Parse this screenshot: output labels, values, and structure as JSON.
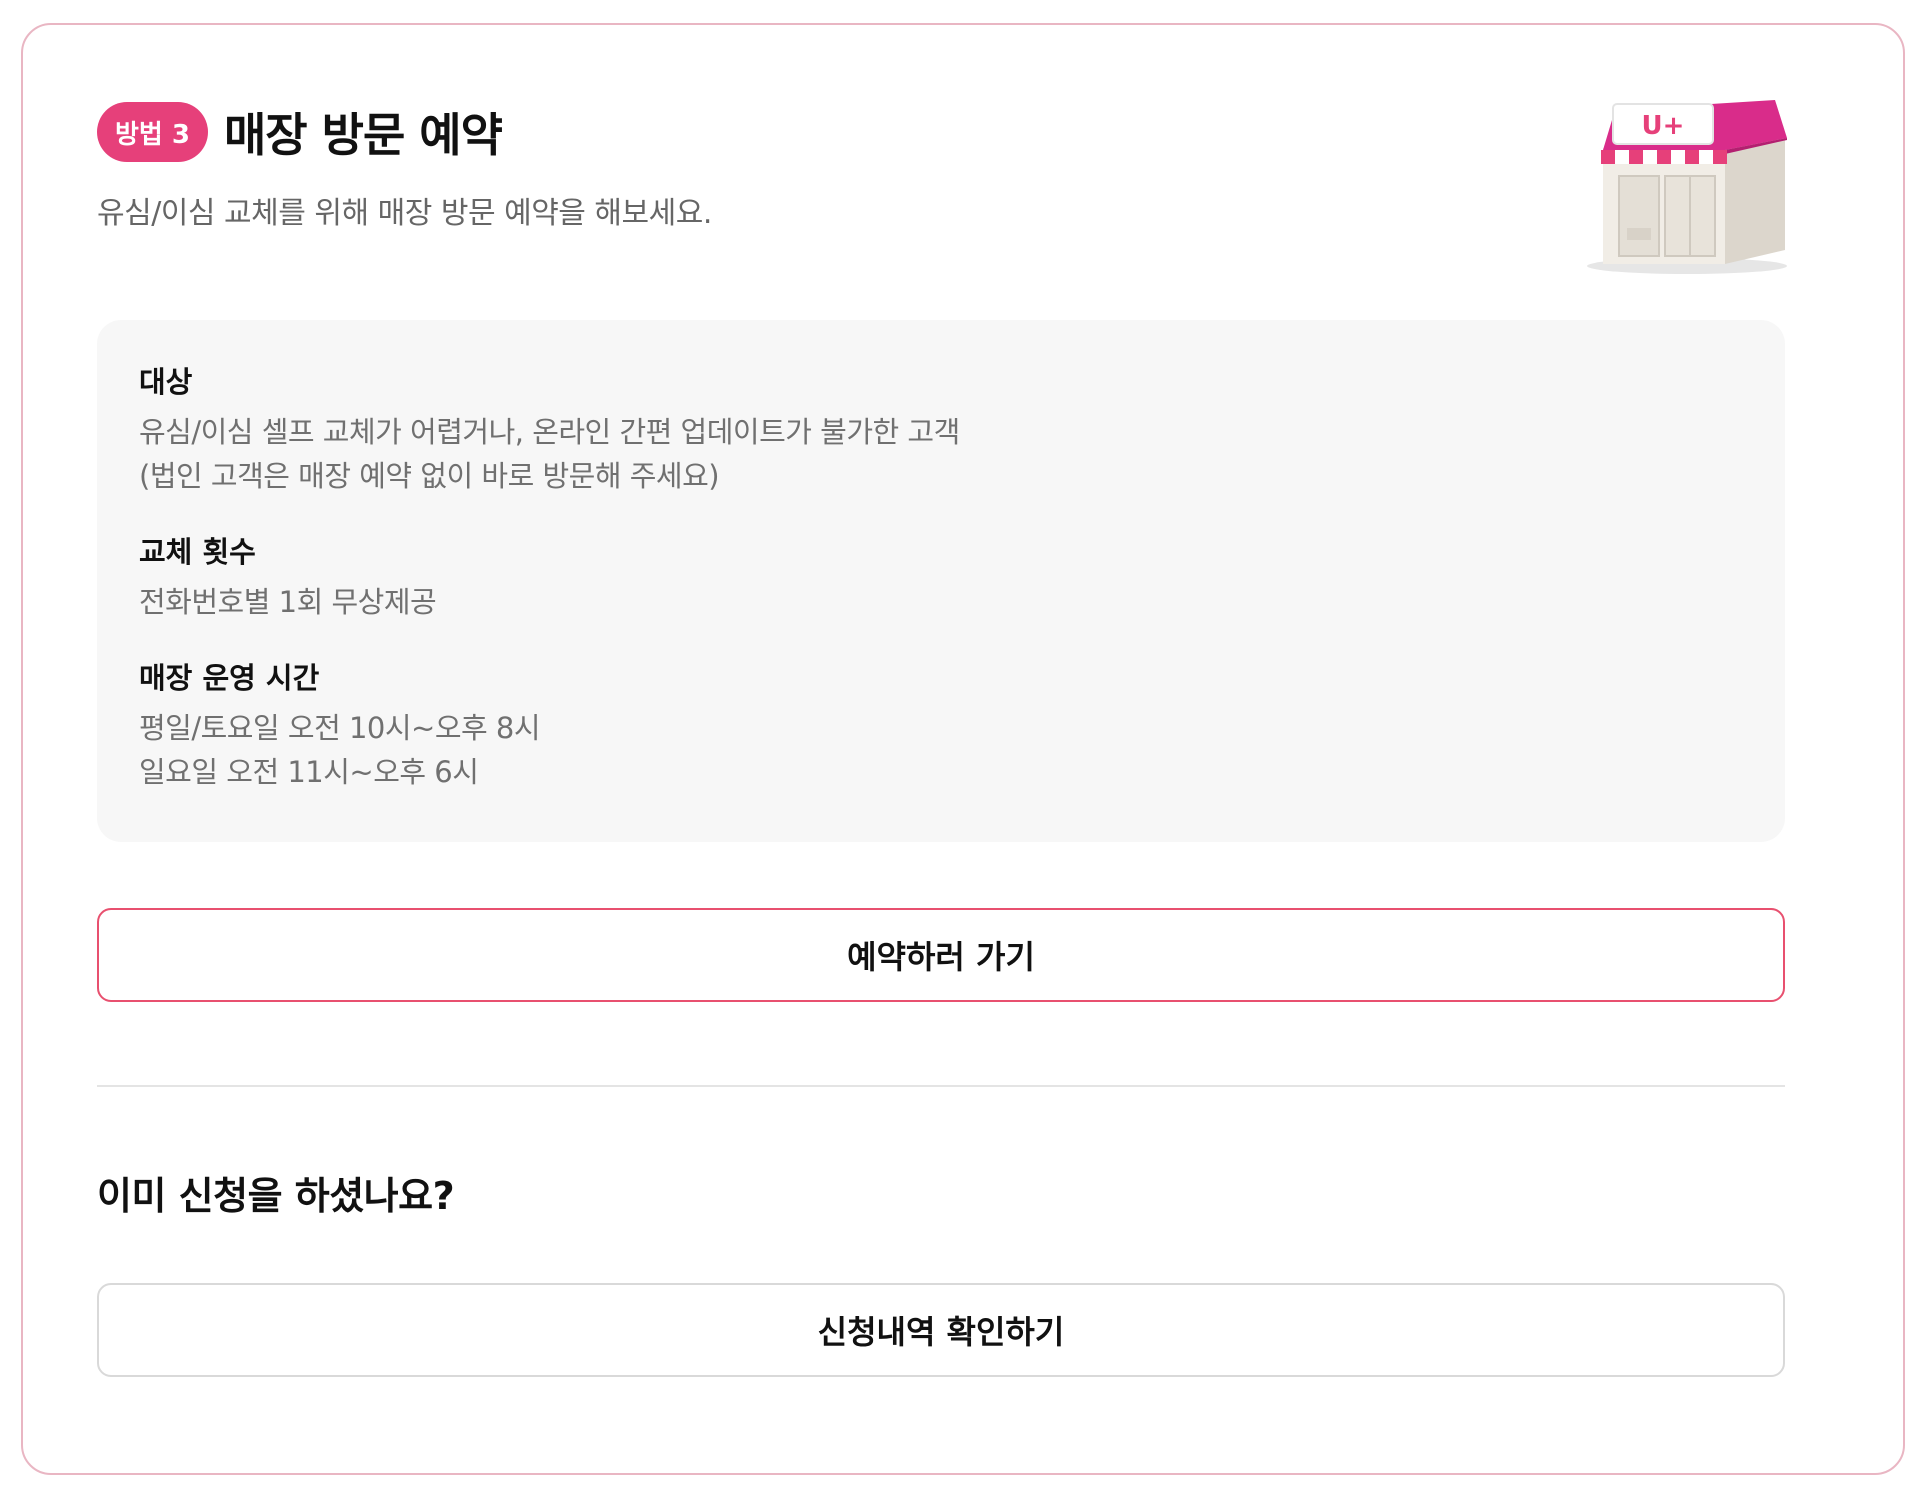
{
  "method": {
    "badge": "방법 3",
    "title": "매장 방문 예약",
    "subtitle": "유심/이심 교체를 위해 매장 방문 예약을 해보세요.",
    "store_illustration_sign": "U+"
  },
  "info": {
    "target": {
      "heading": "대상",
      "line1": "유심/이심 셀프 교체가 어렵거나, 온라인 간편 업데이트가 불가한 고객",
      "line2": "(법인 고객은 매장 예약 없이 바로 방문해 주세요)"
    },
    "count": {
      "heading": "교체 횟수",
      "line1": "전화번호별 1회 무상제공"
    },
    "hours": {
      "heading": "매장 운영 시간",
      "line1": "평일/토요일 오전 10시~오후 8시",
      "line2": "일요일 오전 11시~오후 6시"
    }
  },
  "actions": {
    "reserve_label": "예약하러 가기",
    "already_question": "이미 신청을 하셨나요?",
    "check_label": "신청내역 확인하기"
  },
  "colors": {
    "accent": "#e6407a",
    "card_border": "#e9b6c3",
    "primary_button_border": "#e8506f",
    "info_background": "#f7f7f7"
  }
}
